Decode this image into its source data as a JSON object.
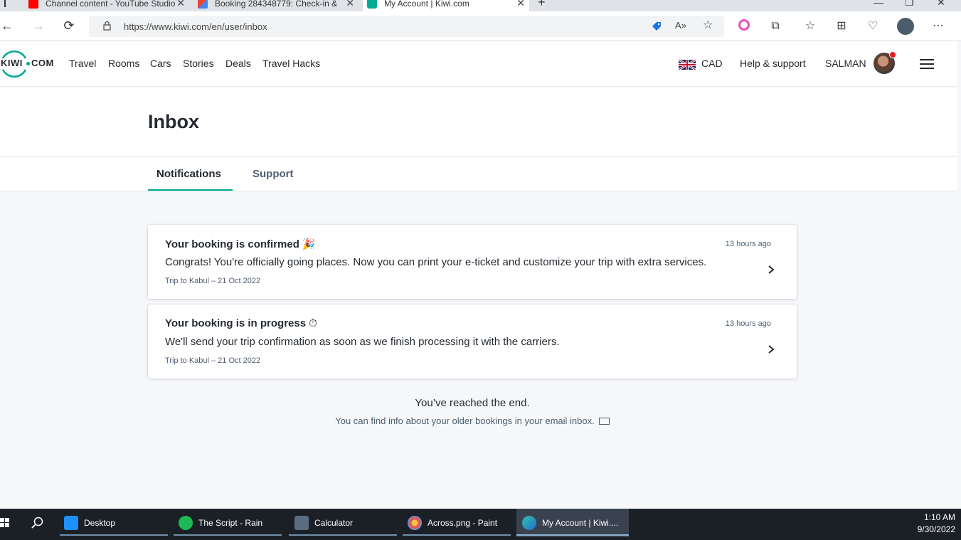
{
  "browser": {
    "tabs": [
      {
        "title": "Channel content - YouTube Studio",
        "icon": "youtube-icon"
      },
      {
        "title": "Booking 284348779: Check-in &",
        "icon": "gmail-icon"
      },
      {
        "title": "My Account | Kiwi.com",
        "icon": "kiwi-icon",
        "active": true
      }
    ],
    "new_tab": "+",
    "url": "https://www.kiwi.com/en/user/inbox",
    "controls": {
      "minimize": "—",
      "restore": "❐",
      "close": "✕"
    }
  },
  "site": {
    "logo": {
      "left": "KIWI",
      "right": "COM"
    },
    "nav": [
      "Travel",
      "Rooms",
      "Cars",
      "Stories",
      "Deals",
      "Travel Hacks"
    ],
    "currency": "CAD",
    "help": "Help & support",
    "user": "SALMAN",
    "accent_color": "#00a991"
  },
  "inbox": {
    "title": "Inbox",
    "tabs": [
      {
        "label": "Notifications",
        "active": true
      },
      {
        "label": "Support",
        "active": false
      }
    ],
    "notifications": [
      {
        "title": "Your booking is confirmed",
        "emoji": "🎉",
        "time": "13 hours ago",
        "body": "Congrats! You're officially going places. Now you can print your e-ticket and customize your trip with extra services.",
        "trip": "Trip to Kabul – 21 Oct 2022"
      },
      {
        "title": "Your booking is in progress",
        "emoji": "⏱",
        "time": "13 hours ago",
        "body": "We'll send your trip confirmation as soon as we finish processing it with the carriers.",
        "trip": "Trip to Kabul – 21 Oct 2022"
      }
    ],
    "end_title": "You’ve reached the end.",
    "end_sub": "You can find info about your older bookings in your email inbox."
  },
  "taskbar": {
    "items": [
      {
        "label": "Desktop",
        "icon": "desktop-icon"
      },
      {
        "label": "The Script - Rain",
        "icon": "spotify-icon"
      },
      {
        "label": "Calculator",
        "icon": "calculator-icon"
      },
      {
        "label": "Across.png - Paint",
        "icon": "paint-icon"
      },
      {
        "label": "My Account | Kiwi....",
        "icon": "edge-icon",
        "active": true
      }
    ],
    "time": "1:10 AM",
    "date": "9/30/2022"
  }
}
